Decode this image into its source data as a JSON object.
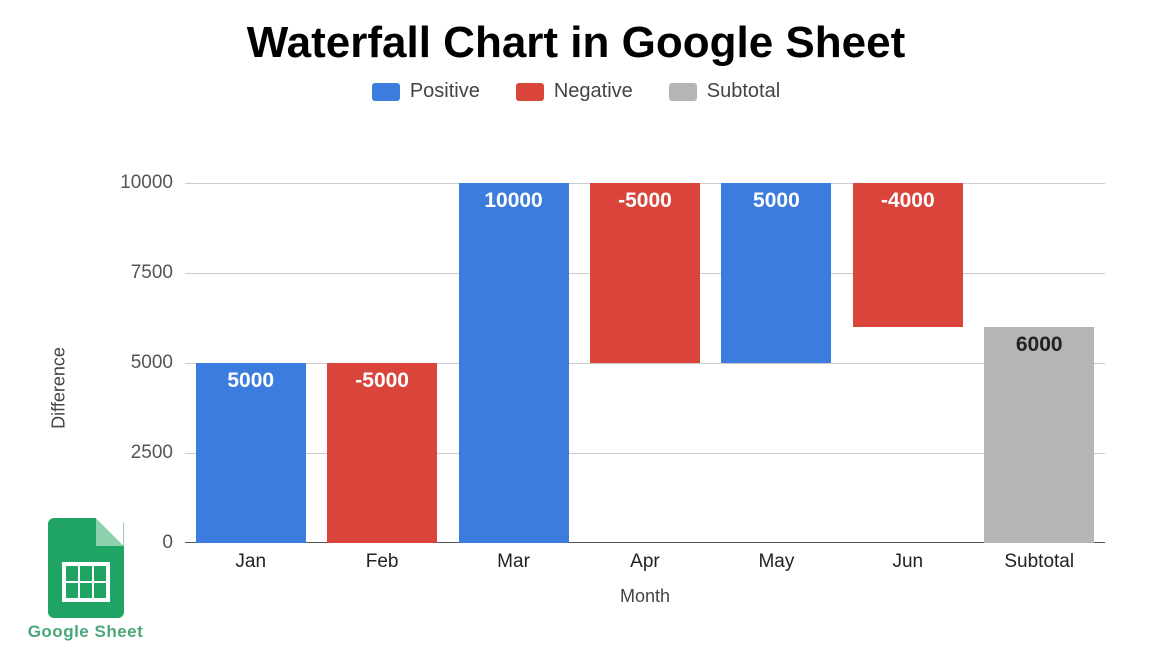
{
  "chart_data": {
    "type": "waterfall",
    "title": "Waterfall Chart in Google Sheet",
    "xlabel": "Month",
    "ylabel": "Difference",
    "ylim": [
      0,
      10000
    ],
    "yticks": [
      0,
      2500,
      5000,
      7500,
      10000
    ],
    "categories": [
      "Jan",
      "Feb",
      "Mar",
      "Apr",
      "May",
      "Jun",
      "Subtotal"
    ],
    "legend": [
      {
        "name": "Positive",
        "color": "#3b7cde"
      },
      {
        "name": "Negative",
        "color": "#d9453a"
      },
      {
        "name": "Subtotal",
        "color": "#b5b5b5"
      }
    ],
    "bars": [
      {
        "category": "Jan",
        "value": 5000,
        "label": "5000",
        "kind": "positive",
        "base": 0,
        "top": 5000
      },
      {
        "category": "Feb",
        "value": -5000,
        "label": "-5000",
        "kind": "negative",
        "base": 0,
        "top": 5000
      },
      {
        "category": "Mar",
        "value": 10000,
        "label": "10000",
        "kind": "positive",
        "base": 0,
        "top": 10000
      },
      {
        "category": "Apr",
        "value": -5000,
        "label": "-5000",
        "kind": "negative",
        "base": 5000,
        "top": 10000
      },
      {
        "category": "May",
        "value": 5000,
        "label": "5000",
        "kind": "positive",
        "base": 5000,
        "top": 10000
      },
      {
        "category": "Jun",
        "value": -4000,
        "label": "-4000",
        "kind": "negative",
        "base": 6000,
        "top": 10000
      },
      {
        "category": "Subtotal",
        "value": 6000,
        "label": "6000",
        "kind": "subtotal",
        "base": 0,
        "top": 6000
      }
    ]
  },
  "logo": {
    "caption": "Google Sheet"
  }
}
